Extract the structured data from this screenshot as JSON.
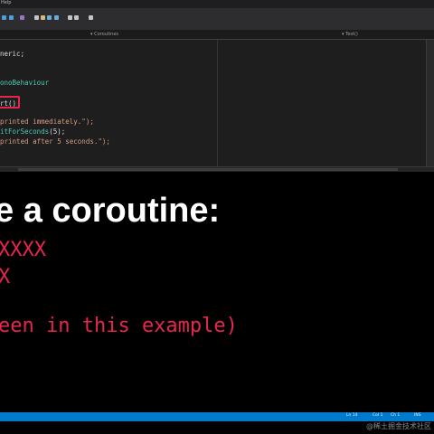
{
  "titlebar": {
    "text": "Help"
  },
  "tabs": {
    "active": "Coroutines",
    "secondary": "Test()"
  },
  "code_lines": [
    {
      "parts": [
        {
          "t": "neric;",
          "c": "kw"
        }
      ]
    },
    {
      "parts": [
        {
          "t": "onoBehaviour",
          "c": "type"
        }
      ]
    },
    {
      "parts": [
        {
          "t": "rt()",
          "c": "kw"
        }
      ]
    },
    {
      "parts": [
        {
          "t": "printed immediately.\");",
          "c": "str"
        }
      ]
    },
    {
      "parts": [
        {
          "t": "itForSeconds",
          "c": "type"
        },
        {
          "t": "(5);",
          "c": "kw"
        }
      ]
    },
    {
      "parts": [
        {
          "t": "printed after 5 seconds.\");",
          "c": "str"
        }
      ]
    }
  ],
  "slide": {
    "title": "e a coroutine:",
    "line1": "XXXX",
    "line2": "X",
    "line3": "een in this example)"
  },
  "statusbar": {
    "ln": "Ln 14",
    "col": "Col 1",
    "ch": "Ch 1",
    "mode": "INS"
  },
  "watermark": "@稀土掘金技术社区",
  "colors": {
    "accent": "#e8254c",
    "statusbar": "#007acc",
    "editor_bg": "#1e1e1e"
  }
}
